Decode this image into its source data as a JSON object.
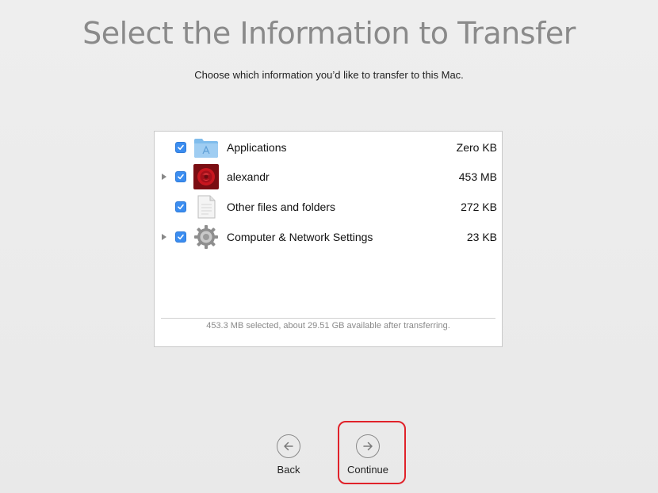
{
  "header": {
    "title": "Select the Information to Transfer",
    "subtitle": "Choose which information you’d like to transfer to this Mac."
  },
  "items": [
    {
      "label": "Applications",
      "size": "Zero KB",
      "checked": true,
      "expandable": false,
      "icon": "applications-folder-icon"
    },
    {
      "label": "alexandr",
      "size": "453 MB",
      "checked": true,
      "expandable": true,
      "icon": "user-avatar-rose-icon"
    },
    {
      "label": "Other files and folders",
      "size": "272 KB",
      "checked": true,
      "expandable": false,
      "icon": "document-icon"
    },
    {
      "label": "Computer & Network Settings",
      "size": "23 KB",
      "checked": true,
      "expandable": true,
      "icon": "gear-icon"
    }
  ],
  "summary": "453.3 MB selected, about 29.51 GB available after transferring.",
  "nav": {
    "back_label": "Back",
    "continue_label": "Continue"
  },
  "colors": {
    "checkbox": "#3b8df0",
    "highlight": "#e0222a",
    "title": "#8a8a8a"
  }
}
